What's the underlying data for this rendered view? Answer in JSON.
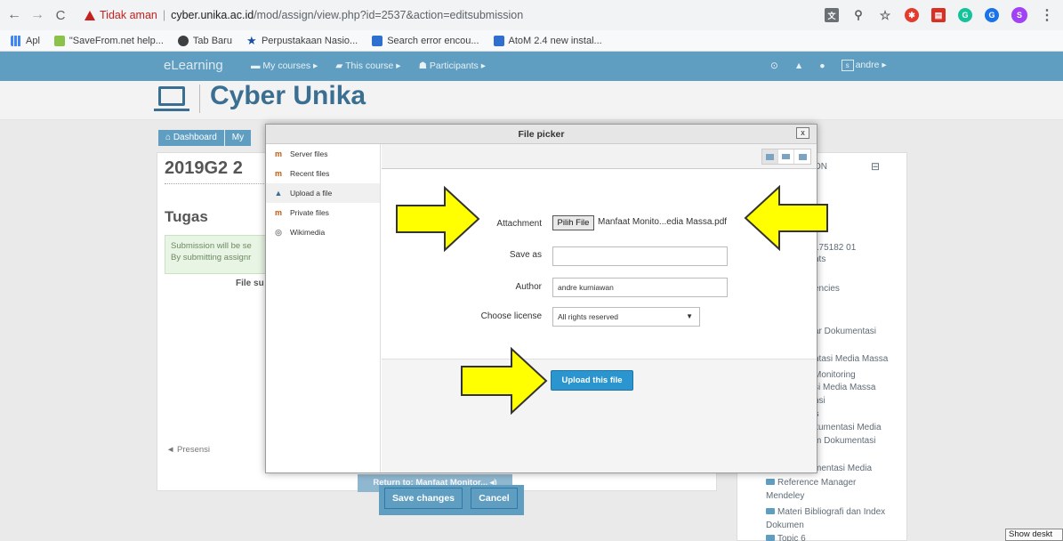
{
  "browser": {
    "back_glyph": "←",
    "forward_glyph": "→",
    "reload_glyph": "C",
    "security_text": "Tidak aman",
    "url_host": "cyber.unika.ac.id",
    "url_path": "/mod/assign/view.php?id=2537&action=editsubmission",
    "profile_initial": "S",
    "menu_glyph": "⋮",
    "extensions": [
      "translate-icon",
      "zoom-icon",
      "star-icon",
      "ext-red-icon",
      "ext-pdf-icon",
      "grammarly-icon",
      "ext-blue-icon"
    ]
  },
  "bookmarks": [
    {
      "label": "Apl",
      "icon": "apps-grid-icon"
    },
    {
      "label": "\"SaveFrom.net help...",
      "icon": "savefrom-icon"
    },
    {
      "label": "Tab Baru",
      "icon": "globe-icon"
    },
    {
      "label": "Perpustakaan Nasio...",
      "icon": "star-blue-icon"
    },
    {
      "label": "Search error encou...",
      "icon": "site-icon"
    },
    {
      "label": "AtoM 2.4 new instal...",
      "icon": "site-icon"
    }
  ],
  "navbar": {
    "brand": "eLearning",
    "links": [
      "My courses ▸",
      "This course ▸",
      "Participants ▸"
    ],
    "user": "andre ▸",
    "avatar_initial": "s"
  },
  "site": {
    "title": "Cyber Unika"
  },
  "breadcrumb": [
    "Dashboard",
    "My"
  ],
  "main": {
    "course_title": "2019G2 2",
    "section_title": "Tugas",
    "notice_line1": "Submission will be se",
    "notice_line2": "By submitting assignr",
    "file_sub": "File su",
    "prev_link": "◄ Presensi"
  },
  "sidebar": {
    "header": "ON",
    "collapse": "⊟",
    "items": [
      "175182 01",
      "nts",
      "encies",
      "ar Dokumentasi",
      "ntasi Media Massa",
      "Monitoring",
      "si Media Massa",
      "nsi",
      "s",
      "kumentasi Media",
      "m Dokumentasi",
      "mentasi Media",
      "Reference Manager",
      "Mendeley",
      "Materi Bibliografi dan Index",
      "Dokumen",
      "Topic 6"
    ]
  },
  "footer_buttons": {
    "return": "Return to: Manfaat Monitor... ◂)",
    "save": "Save changes",
    "cancel": "Cancel"
  },
  "picker": {
    "title": "File picker",
    "close": "x",
    "repositories": [
      {
        "label": "Server files",
        "icon": "moodle-icon"
      },
      {
        "label": "Recent files",
        "icon": "moodle-icon"
      },
      {
        "label": "Upload a file",
        "icon": "upload-icon",
        "active": true
      },
      {
        "label": "Private files",
        "icon": "moodle-icon"
      },
      {
        "label": "Wikimedia",
        "icon": "wikimedia-icon"
      }
    ],
    "attachment_label": "Attachment",
    "choose_file_button": "Pilih File",
    "chosen_file": "Manfaat Monito...edia Massa.pdf",
    "saveas_label": "Save as",
    "saveas_value": "",
    "author_label": "Author",
    "author_value": "andre kurniawan",
    "license_label": "Choose license",
    "license_value": "All rights reserved",
    "upload_button": "Upload this file"
  },
  "taskbar": {
    "show_desktop": "Show deskt"
  },
  "colors": {
    "navbar": "#5f9ec1",
    "title": "#3a6f91",
    "upload": "#2b95cf",
    "arrow_fill": "#ffff00"
  }
}
